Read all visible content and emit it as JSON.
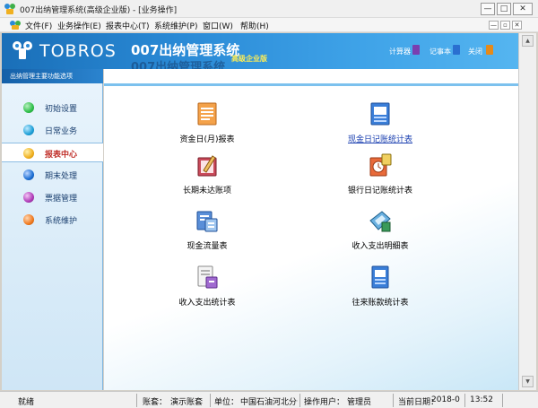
{
  "window": {
    "title": "007出纳管理系统(高级企业版) - [业务操作]",
    "controls": {
      "minimize": "—",
      "maximize": "□",
      "close": "✕"
    }
  },
  "menu": {
    "items": [
      {
        "label": "文件(F)"
      },
      {
        "label": "业务操作(E)"
      },
      {
        "label": "报表中心(T)"
      },
      {
        "label": "系统维护(P)"
      },
      {
        "label": "窗口(W)"
      },
      {
        "label": "帮助(H)"
      }
    ],
    "mdi_controls": {
      "minimize": "—",
      "restore": "▫",
      "close": "✕"
    }
  },
  "header": {
    "logo_text": "TOBROS",
    "product_name": "007出纳管理系统",
    "edition": "高级企业版",
    "tools": [
      {
        "label": "计算器",
        "icon": "calculator-icon",
        "color": "#7a3fb0"
      },
      {
        "label": "记事本",
        "icon": "notepad-icon",
        "color": "#2a6fd0"
      },
      {
        "label": "关闭",
        "icon": "close-door-icon",
        "color": "#e58a1a"
      }
    ]
  },
  "left_panel": {
    "title": "出纳管理主要功能选项",
    "items": [
      {
        "label": "初始设置",
        "color": "#2fbf4a",
        "active": false
      },
      {
        "label": "日常业务",
        "color": "#1ea0d8",
        "active": false
      },
      {
        "label": "报表中心",
        "color": "#f0b020",
        "active": true
      },
      {
        "label": "期末处理",
        "color": "#1c6fd4",
        "active": false
      },
      {
        "label": "票据管理",
        "color": "#b03cb8",
        "active": false
      },
      {
        "label": "系统维护",
        "color": "#f07a20",
        "active": false
      }
    ]
  },
  "reports": [
    {
      "label": "资金日(月)报表",
      "icon": "fund-report-icon"
    },
    {
      "label": "现金日记账统计表",
      "icon": "cash-journal-icon"
    },
    {
      "label": "长期未达账项",
      "icon": "long-outstanding-icon"
    },
    {
      "label": "银行日记账统计表",
      "icon": "bank-journal-icon"
    },
    {
      "label": "现金流量表",
      "icon": "cash-flow-icon"
    },
    {
      "label": "收入支出明细表",
      "icon": "income-detail-icon"
    },
    {
      "label": "收入支出统计表",
      "icon": "income-stats-icon"
    },
    {
      "label": "往来账款统计表",
      "icon": "accounts-stats-icon"
    }
  ],
  "status": {
    "ready": "就绪",
    "account_label": "账套：",
    "account_value": "演示账套",
    "unit_label": "单位：",
    "unit_value": "中国石油河北分公",
    "operator_label": "操作用户：",
    "operator_value": "管理员",
    "date_label": "当前日期：",
    "date_value": "2018-0",
    "time_value": "13:52"
  }
}
